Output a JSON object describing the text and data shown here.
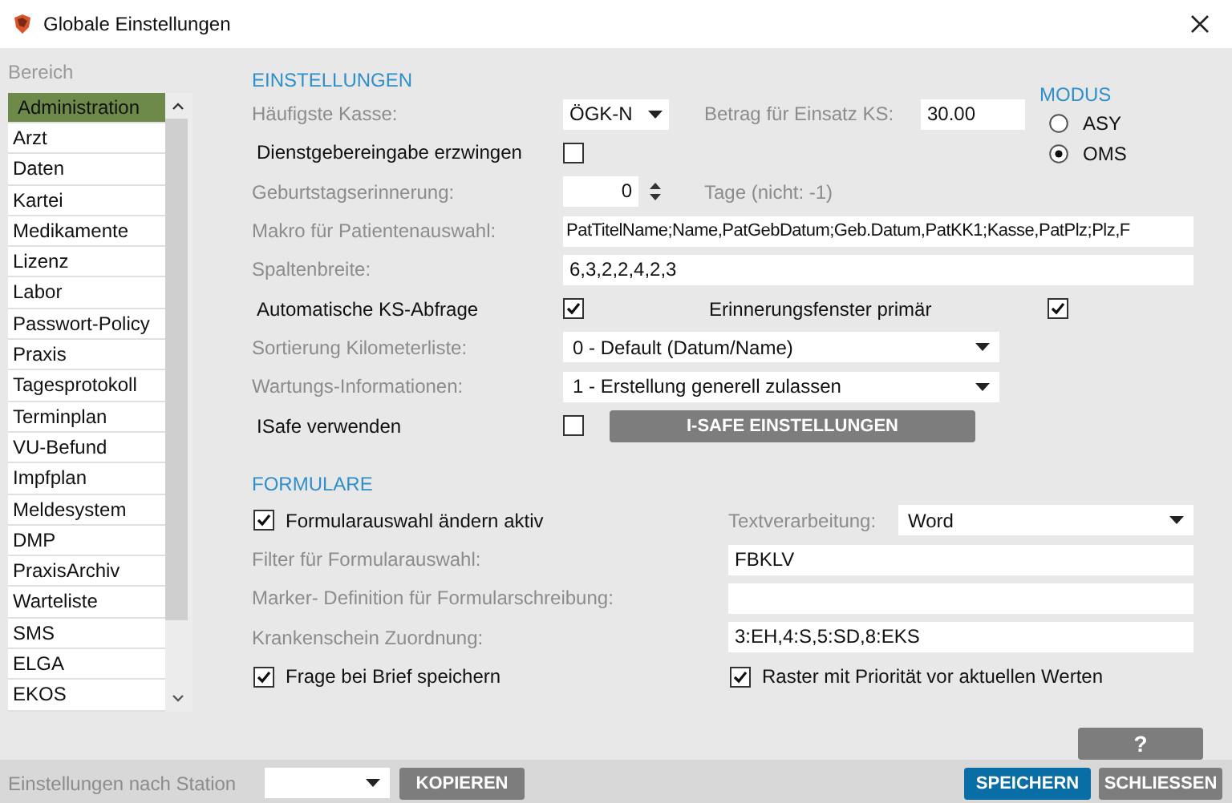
{
  "window": {
    "title": "Globale Einstellungen"
  },
  "sidebar": {
    "heading": "Bereich",
    "items": [
      {
        "label": "Administration",
        "selected": true
      },
      {
        "label": "Arzt",
        "selected": false
      },
      {
        "label": "Daten",
        "selected": false
      },
      {
        "label": "Kartei",
        "selected": false
      },
      {
        "label": "Medikamente",
        "selected": false
      },
      {
        "label": "Lizenz",
        "selected": false
      },
      {
        "label": "Labor",
        "selected": false
      },
      {
        "label": "Passwort-Policy",
        "selected": false
      },
      {
        "label": "Praxis",
        "selected": false
      },
      {
        "label": "Tagesprotokoll",
        "selected": false
      },
      {
        "label": "Terminplan",
        "selected": false
      },
      {
        "label": "VU-Befund",
        "selected": false
      },
      {
        "label": "Impfplan",
        "selected": false
      },
      {
        "label": "Meldesystem",
        "selected": false
      },
      {
        "label": "DMP",
        "selected": false
      },
      {
        "label": "PraxisArchiv",
        "selected": false
      },
      {
        "label": "Warteliste",
        "selected": false
      },
      {
        "label": "SMS",
        "selected": false
      },
      {
        "label": "ELGA",
        "selected": false
      },
      {
        "label": "EKOS",
        "selected": false
      }
    ]
  },
  "einstellungen": {
    "heading": "EINSTELLUNGEN",
    "kasse": {
      "label": "Häufigste Kasse:",
      "value": "ÖGK-N"
    },
    "betrag": {
      "label": "Betrag für Einsatz KS:",
      "value": "30.00"
    },
    "modus": {
      "heading": "MODUS",
      "options": [
        {
          "label": "ASY",
          "selected": false
        },
        {
          "label": "OMS",
          "selected": true
        }
      ]
    },
    "dienstgeber": {
      "label": "Dienstgebereingabe erzwingen",
      "checked": false
    },
    "geburtstag": {
      "label": "Geburtstagserinnerung:",
      "value": "0",
      "unit": "Tage  (nicht: -1)"
    },
    "makro": {
      "label": "Makro für Patientenauswahl:",
      "value": "PatTitelName;Name,PatGebDatum;Geb.Datum,PatKK1;Kasse,PatPlz;Plz,F"
    },
    "spalten": {
      "label": "Spaltenbreite:",
      "value": "6,3,2,2,4,2,3"
    },
    "auto_ks": {
      "label": "Automatische KS-Abfrage",
      "checked": true
    },
    "erinnerung": {
      "label": "Erinnerungsfenster primär",
      "checked": true
    },
    "sortierung": {
      "label": "Sortierung Kilometerliste:",
      "value": "0 - Default (Datum/Name)"
    },
    "wartung": {
      "label": "Wartungs-Informationen:",
      "value": "1 - Erstellung generell zulassen"
    },
    "isafe": {
      "label": "ISafe verwenden",
      "checked": false,
      "button": "I-SAFE EINSTELLUNGEN"
    }
  },
  "formulare": {
    "heading": "FORMULARE",
    "formularauswahl": {
      "label": "Formularauswahl ändern aktiv",
      "checked": true
    },
    "textverarbeitung": {
      "label": "Textverarbeitung:",
      "value": "Word"
    },
    "filter": {
      "label": "Filter für Formularauswahl:",
      "value": "FBKLV"
    },
    "marker": {
      "label": "Marker- Definition für Formularschreibung:"
    },
    "zuordnung": {
      "label": "Krankenschein Zuordnung:",
      "value": "3:EH,4:S,5:SD,8:EKS"
    },
    "frage": {
      "label": "Frage bei Brief speichern",
      "checked": true
    },
    "raster": {
      "label": "Raster mit Priorität vor aktuellen Werten",
      "checked": true
    }
  },
  "help_button": "?",
  "footer": {
    "label": "Einstellungen nach Station",
    "copy_button": "KOPIEREN",
    "save_button": "SPEICHERN",
    "close_button": "SCHLIESSEN"
  }
}
